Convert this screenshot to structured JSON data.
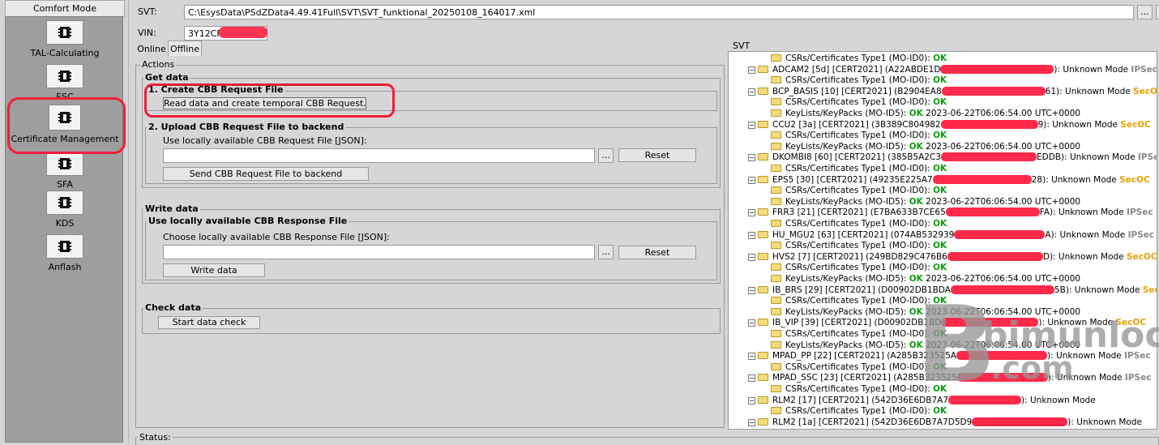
{
  "sidebar": {
    "mode": "Comfort Mode",
    "items": [
      {
        "label": "TAL-Calculating"
      },
      {
        "label": "ESC"
      },
      {
        "label": "Certificate Management"
      },
      {
        "label": "SFA"
      },
      {
        "label": "KDS"
      },
      {
        "label": "Anflash"
      }
    ]
  },
  "svt": {
    "label": "SVT:",
    "value": "C:\\EsysData\\PSdZData4.49.41Full\\SVT\\SVT_funktional_20250108_164017.xml",
    "browse": "..."
  },
  "vin": {
    "label": "VIN:",
    "value": "3Y12CF"
  },
  "tabs": [
    {
      "label": "Online"
    },
    {
      "label": "Offline"
    }
  ],
  "actions": {
    "title": "Actions",
    "get_data": {
      "title": "Get data",
      "step1": {
        "title": "1. Create CBB Request File",
        "button": "Read data and create temporal CBB Request..."
      },
      "step2": {
        "title": "2. Upload CBB Request File to backend",
        "prompt": "Use locally available CBB Request File [JSON]:",
        "browse": "...",
        "reset": "Reset",
        "send": "Send CBB Request File to backend"
      }
    },
    "write_data": {
      "title": "Write data",
      "sub_title": "Use locally available CBB Response File",
      "prompt": "Choose locally available CBB Response File [JSON]:",
      "browse": "...",
      "reset": "Reset",
      "button": "Write data"
    },
    "check_data": {
      "title": "Check data",
      "button": "Start data check"
    }
  },
  "status": {
    "label": "Status:"
  },
  "tree": {
    "title": "SVT",
    "rows": [
      {
        "kind": "child",
        "text": "CSRs/Certificates Type1 (MO-ID0): ",
        "status": "OK",
        "mode": ""
      },
      {
        "kind": "parent",
        "text": "ADCAM2 [5d] [CERT2021] (A22ABDE1D",
        "suffix": "): Unknown Mode ",
        "mode": "IPSec"
      },
      {
        "kind": "child",
        "text": "CSRs/Certificates Type1 (MO-ID0): ",
        "status": "OK",
        "mode": ""
      },
      {
        "kind": "parent",
        "text": "BCP_BASIS [10] [CERT2021] (B2904EA8",
        "suffix": "61): Unknown Mode ",
        "mode": "SecOC"
      },
      {
        "kind": "child",
        "text": "CSRs/Certificates Type1 (MO-ID0): ",
        "status": "OK",
        "mode": ""
      },
      {
        "kind": "child",
        "text": "KeyLists/KeyPacks (MO-ID5): ",
        "status": "OK",
        "extra": " 2023-06-22T06:06:54.00 UTC+0000"
      },
      {
        "kind": "parent",
        "text": "CCU2 [3a] [CERT2021] (3B389C804982",
        "suffix": "9): Unknown Mode ",
        "mode": "SecOC"
      },
      {
        "kind": "child",
        "text": "CSRs/Certificates Type1 (MO-ID0): ",
        "status": "OK",
        "mode": ""
      },
      {
        "kind": "child",
        "text": "KeyLists/KeyPacks (MO-ID5): ",
        "status": "OK",
        "extra": " 2023-06-22T06:06:54.00 UTC+0000"
      },
      {
        "kind": "parent",
        "text": "DKOMBI8 [60] [CERT2021] (385B5A2C3",
        "suffix": "EDDB): Unknown Mode ",
        "mode": "IPSec"
      },
      {
        "kind": "child",
        "text": "CSRs/Certificates Type1 (MO-ID0): ",
        "status": "OK",
        "mode": ""
      },
      {
        "kind": "parent",
        "text": "EPS5 [30] [CERT2021] (49235E225A7",
        "suffix": "28): Unknown Mode ",
        "mode": "SecOC"
      },
      {
        "kind": "child",
        "text": "CSRs/Certificates Type1 (MO-ID0): ",
        "status": "OK",
        "mode": ""
      },
      {
        "kind": "child",
        "text": "KeyLists/KeyPacks (MO-ID5): ",
        "status": "OK",
        "extra": " 2023-06-22T06:06:54.00 UTC+0000"
      },
      {
        "kind": "parent",
        "text": "FRR3 [21] [CERT2021] (E7BA633B7CE65",
        "suffix": "FA): Unknown Mode ",
        "mode": "IPSec"
      },
      {
        "kind": "child",
        "text": "CSRs/Certificates Type1 (MO-ID0): ",
        "status": "OK",
        "mode": ""
      },
      {
        "kind": "parent",
        "text": "HU_MGU2 [63] [CERT2021] (074AB532939",
        "suffix": "A): Unknown Mode ",
        "mode": "IPSec"
      },
      {
        "kind": "child",
        "text": "CSRs/Certificates Type1 (MO-ID0): ",
        "status": "OK",
        "mode": ""
      },
      {
        "kind": "parent",
        "text": "HVS2 [7] [CERT2021] (249BD829C476B6",
        "suffix": "D): Unknown Mode ",
        "mode": "SecOC"
      },
      {
        "kind": "child",
        "text": "CSRs/Certificates Type1 (MO-ID0): ",
        "status": "OK",
        "mode": ""
      },
      {
        "kind": "child",
        "text": "KeyLists/KeyPacks (MO-ID5): ",
        "status": "OK",
        "extra": " 2023-06-22T06:06:54.00 UTC+0000"
      },
      {
        "kind": "parent",
        "text": "IB_BRS [29] [CERT2021] (D00902DB1BDA",
        "suffix": "5B): Unknown Mode ",
        "mode": "SecOC"
      },
      {
        "kind": "child",
        "text": "CSRs/Certificates Type1 (MO-ID0): ",
        "status": "OK",
        "mode": ""
      },
      {
        "kind": "child",
        "text": "KeyLists/KeyPacks (MO-ID5): ",
        "status": "OK",
        "extra": " 2023-06-22T06:06:54.00 UTC+0000"
      },
      {
        "kind": "parent",
        "text": "IB_VIP [39] [CERT2021] (D00902DB1BD",
        "suffix": "): Unknown Mode ",
        "mode": "SecOC"
      },
      {
        "kind": "child",
        "text": "CSRs/Certificates Type1 (MO-ID0): ",
        "status": "OK",
        "mode": ""
      },
      {
        "kind": "child",
        "text": "KeyLists/KeyPacks (MO-ID5): ",
        "status": "OK",
        "extra": " 2023-06-22T06:06:54.00 UTC+0000"
      },
      {
        "kind": "parent",
        "text": "MPAD_PP [22] [CERT2021] (A285B323525A",
        "suffix": "): Unknown Mode ",
        "mode": "IPSec"
      },
      {
        "kind": "child",
        "text": "CSRs/Certificates Type1 (MO-ID0): ",
        "status": "OK",
        "mode": ""
      },
      {
        "kind": "parent",
        "text": "MPAD_SSC [23] [CERT2021] (A285B323525",
        "suffix": "): Unknown Mode ",
        "mode": "IPSec"
      },
      {
        "kind": "child",
        "text": "CSRs/Certificates Type1 (MO-ID0): ",
        "status": "OK",
        "mode": ""
      },
      {
        "kind": "parent",
        "text": "RLM2 [17] [CERT2021] (542D36E6DB7A7",
        "suffix": "): Unknown Mode",
        "mode": ""
      },
      {
        "kind": "child",
        "text": "CSRs/Certificates Type1 (MO-ID0): ",
        "status": "OK",
        "mode": ""
      },
      {
        "kind": "parent",
        "text": "RLM2 [1a] [CERT2021] (542D36E6DB7A7D5D9",
        "suffix": "): Unknown Mode",
        "mode": ""
      }
    ]
  },
  "watermark": {
    "letter": "B",
    "line1": "bimunlock",
    "line2": ".com"
  }
}
